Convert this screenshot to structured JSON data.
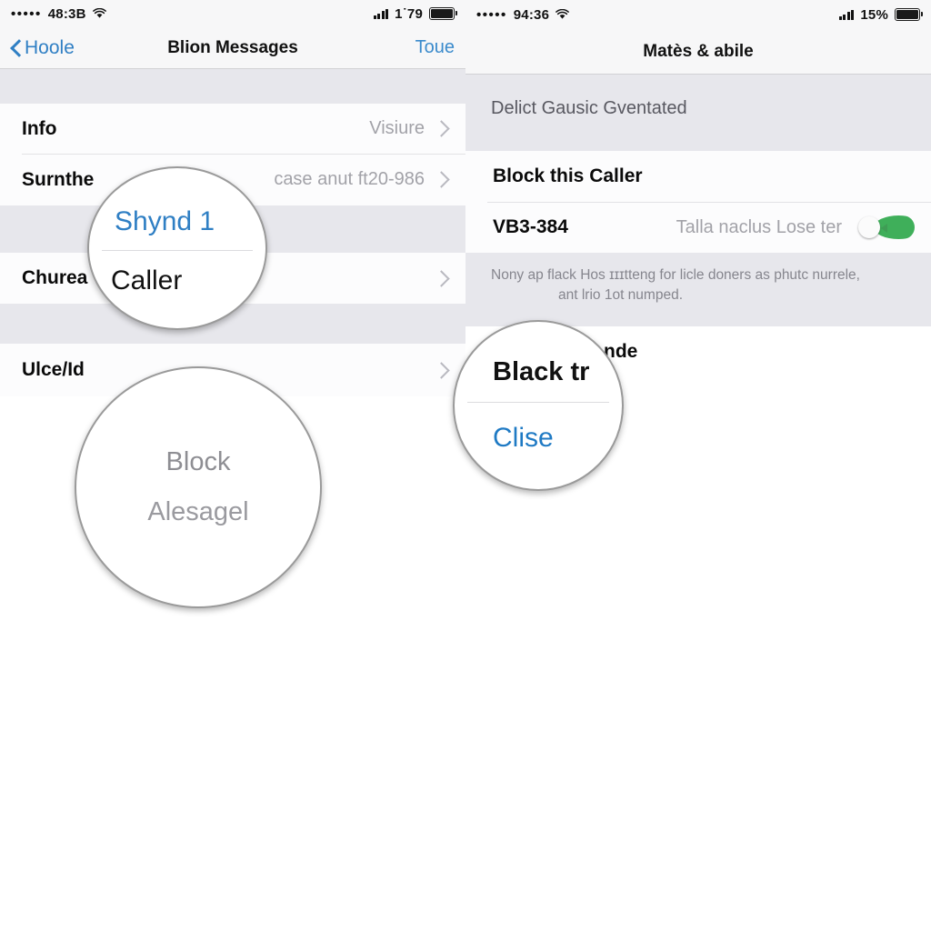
{
  "left_panel": {
    "status_bar": {
      "carrier_dots": "•••••",
      "time": "48:3B",
      "wifi_icon": "wifi-icon",
      "signal_icon": "signal-bars-icon",
      "battery_text": "1˙79",
      "battery_icon": "battery-full-icon"
    },
    "nav": {
      "back_label": "Hoole",
      "back_icon": "chevron-left-icon",
      "title": "Blion Messages",
      "action_label": "Toue"
    },
    "rows": [
      {
        "label": "Info",
        "value": "Visiure",
        "chevron": true,
        "bold": true
      },
      {
        "label": "Surnthe",
        "value": "case anut ft20-986",
        "chevron": true,
        "bold": true
      },
      {
        "label": "Churea",
        "value": "",
        "chevron": true,
        "bold": true
      },
      {
        "label": "Ulce/Id",
        "value": "",
        "chevron": true,
        "bold": true
      }
    ],
    "loupe_top": {
      "line1": "Shynd 1",
      "line2": "Caller"
    },
    "loupe_bottom": {
      "line1": "Block",
      "line2": "Alesagel"
    }
  },
  "right_panel": {
    "status_bar": {
      "carrier_dots": "•••••",
      "time": "94:36",
      "wifi_icon": "wifi-icon",
      "signal_icon": "signal-bars-icon",
      "battery_text": "15%",
      "battery_icon": "battery-full-icon"
    },
    "nav": {
      "title": "Matès & abile"
    },
    "section_header": "Delict Gausic Gventated",
    "rows": [
      {
        "label": "Block this Caller",
        "value": "",
        "toggle": false
      },
      {
        "label": "VB3-384",
        "value": "Talla naclus Lose ter",
        "toggle": true
      }
    ],
    "section_footer_line1": "Nony ap flack Hos ɪɪɪtteng for licle doners as phutc nurrele,",
    "section_footer_line2": "ant lrio 1ot numped.",
    "bottom_row_label": "nde",
    "loupe": {
      "line1": "Black tr",
      "line2": "Clise"
    }
  },
  "colors": {
    "ios_blue": "#2f7fc4",
    "toggle_green": "#3faf5a",
    "gray_bg": "#e7e7ec",
    "row_bg": "#fcfcfd",
    "text_secondary": "#a2a2a8"
  }
}
